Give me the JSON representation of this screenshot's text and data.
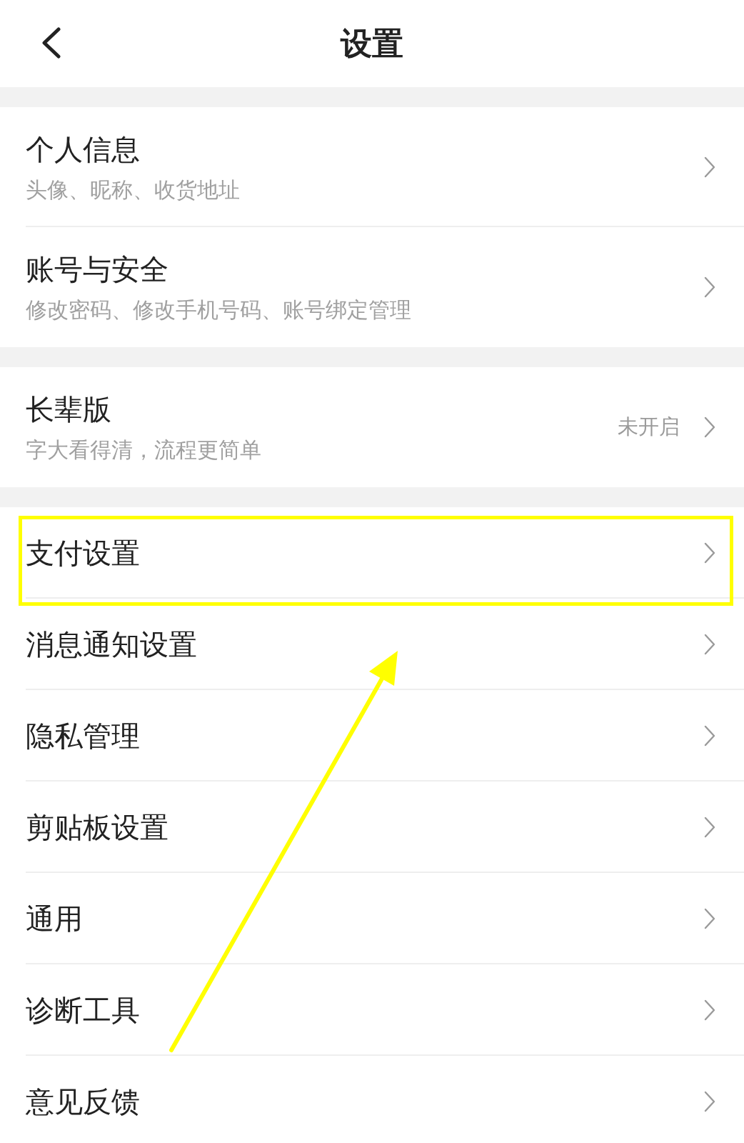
{
  "header": {
    "title": "设置"
  },
  "groups": [
    {
      "items": [
        {
          "title": "个人信息",
          "subtitle": "头像、昵称、收货地址",
          "highlighted": false
        },
        {
          "title": "账号与安全",
          "subtitle": "修改密码、修改手机号码、账号绑定管理",
          "highlighted": false
        }
      ]
    },
    {
      "items": [
        {
          "title": "长辈版",
          "subtitle": "字大看得清，流程更简单",
          "value": "未开启",
          "highlighted": false
        }
      ]
    },
    {
      "items": [
        {
          "title": "支付设置",
          "highlighted": true
        },
        {
          "title": "消息通知设置",
          "highlighted": false
        },
        {
          "title": "隐私管理",
          "highlighted": false
        },
        {
          "title": "剪贴板设置",
          "highlighted": false
        },
        {
          "title": "通用",
          "highlighted": false
        },
        {
          "title": "诊断工具",
          "highlighted": false
        },
        {
          "title": "意见反馈",
          "highlighted": false
        }
      ]
    }
  ]
}
